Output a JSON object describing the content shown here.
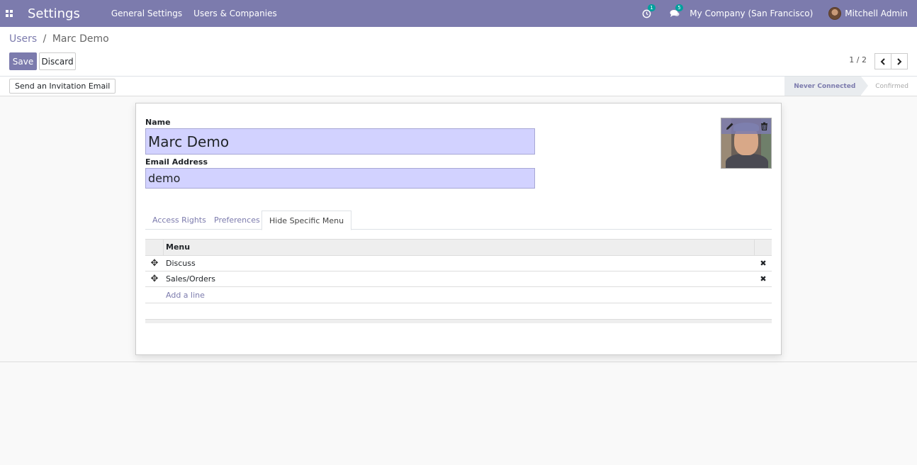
{
  "navbar": {
    "brand": "Settings",
    "menus": [
      "General Settings",
      "Users & Companies"
    ],
    "activity_badge": "1",
    "messages_badge": "5",
    "company": "My Company (San Francisco)",
    "user": "Mitchell Admin",
    "color": "#7c7bad"
  },
  "breadcrumb": {
    "parent": "Users",
    "separator": "/",
    "current": "Marc Demo"
  },
  "buttons": {
    "save": "Save",
    "discard": "Discard",
    "invite": "Send an Invitation Email"
  },
  "pager": {
    "text": "1 / 2"
  },
  "status": {
    "stages": [
      "Never Connected",
      "Confirmed"
    ],
    "active": "Never Connected"
  },
  "form": {
    "name_label": "Name",
    "name_value": "Marc Demo",
    "email_label": "Email Address",
    "email_value": "demo"
  },
  "tabs": [
    "Access Rights",
    "Preferences",
    "Hide Specific Menu"
  ],
  "active_tab": "Hide Specific Menu",
  "menu_list": {
    "header": "Menu",
    "rows": [
      "Discuss",
      "Sales/Orders"
    ],
    "add_line": "Add a line"
  },
  "icons": {
    "apps": "apps-grid-icon",
    "activity": "clock-icon",
    "messages": "chat-bubbles-icon",
    "edit": "pencil-icon",
    "delete": "trash-icon",
    "drag": "drag-handle-icon",
    "remove": "close-icon",
    "prev": "chevron-left-icon",
    "next": "chevron-right-icon"
  }
}
